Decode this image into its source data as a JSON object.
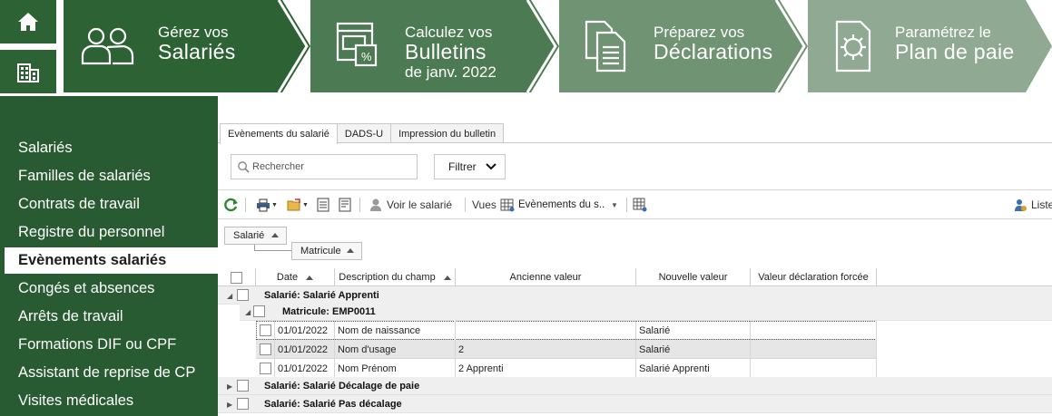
{
  "nav": {
    "home_label": "Accueil",
    "company_label": "Société"
  },
  "steps": [
    {
      "line1": "Gérez vos",
      "line2": "Salariés",
      "line3": ""
    },
    {
      "line1": "Calculez vos",
      "line2": "Bulletins",
      "line3": "de janv. 2022"
    },
    {
      "line1": "Préparez vos",
      "line2": "Déclarations",
      "line3": ""
    },
    {
      "line1": "Paramétrez le",
      "line2": "Plan de paie",
      "line3": ""
    }
  ],
  "sidebar": {
    "items": [
      {
        "label": "Salariés"
      },
      {
        "label": "Familles de salariés"
      },
      {
        "label": "Contrats de travail"
      },
      {
        "label": "Registre du personnel"
      },
      {
        "label": "Evènements salariés"
      },
      {
        "label": "Congés et absences"
      },
      {
        "label": "Arrêts de travail"
      },
      {
        "label": "Formations DIF ou CPF"
      },
      {
        "label": "Assistant de reprise de CP"
      },
      {
        "label": "Visites médicales"
      }
    ],
    "active_index": 4
  },
  "tabs": [
    {
      "label": "Evènements du salarié"
    },
    {
      "label": "DADS-U"
    },
    {
      "label": "Impression du bulletin"
    }
  ],
  "search": {
    "placeholder": "Rechercher"
  },
  "filter": {
    "label": "Filtrer"
  },
  "toolbar": {
    "view_employee": "Voir le salarié",
    "vues_label": "Vues",
    "vues_value": "Evènements du s...",
    "liste_label": "Liste"
  },
  "grouping": {
    "level1": "Salarié",
    "level2": "Matricule"
  },
  "columns": {
    "date": "Date",
    "description": "Description du champ",
    "old_value": "Ancienne valeur",
    "new_value": "Nouvelle valeur",
    "forced": "Valeur déclaration forcée"
  },
  "groups": [
    {
      "label": "Salarié: Salarié Apprenti"
    },
    {
      "label": "Salarié: Salarié Décalage de paie"
    },
    {
      "label": "Salarié: Salarié Pas décalage"
    }
  ],
  "subgroup": {
    "label": "Matricule: EMP0011"
  },
  "rows": [
    {
      "date": "01/01/2022",
      "description": "Nom de naissance",
      "old_value": "",
      "new_value": "Salarié",
      "forced": ""
    },
    {
      "date": "01/01/2022",
      "description": "Nom d'usage",
      "old_value": "2",
      "new_value": "Salarié",
      "forced": ""
    },
    {
      "date": "01/01/2022",
      "description": "Nom Prénom",
      "old_value": "2 Apprenti",
      "new_value": "Salarié Apprenti",
      "forced": ""
    }
  ],
  "colors": {
    "dark_green": "#2d6234",
    "mid_green": "#4c7a52",
    "light_green": "#6f9373",
    "pale_green": "#8fa993",
    "sidebar": "#285b31"
  }
}
